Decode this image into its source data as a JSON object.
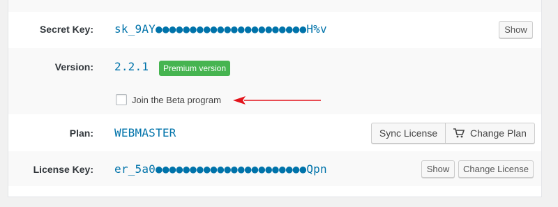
{
  "rows": {
    "secret_key": {
      "label": "Secret Key:",
      "value": "sk_9AY●●●●●●●●●●●●●●●●●●●●●●H%v",
      "show_button": "Show"
    },
    "version": {
      "label": "Version:",
      "value": "2.2.1",
      "badge": "Premium version",
      "beta_checkbox_label": "Join the Beta program",
      "beta_checked": false
    },
    "plan": {
      "label": "Plan:",
      "value": "WEBMASTER",
      "sync_button": "Sync License",
      "change_plan_button": "Change Plan"
    },
    "license_key": {
      "label": "License Key:",
      "value": "er_5a0●●●●●●●●●●●●●●●●●●●●●●Qpn",
      "show_button": "Show",
      "change_button": "Change License"
    }
  },
  "icons": {
    "change_plan": "cart-icon",
    "annotation": "red-arrow"
  },
  "colors": {
    "value_text": "#0073aa",
    "badge_bg": "#46b450",
    "arrow": "#e3131b",
    "row_alt_bg": "#f9f9f9"
  }
}
